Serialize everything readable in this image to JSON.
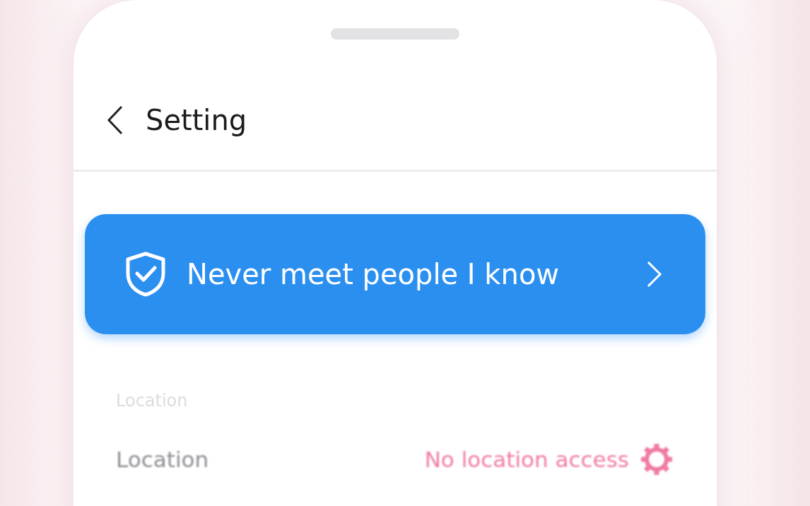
{
  "header": {
    "title": "Setting"
  },
  "banner": {
    "text": "Never meet people I know"
  },
  "sections": [
    {
      "label": "Location",
      "rows": [
        {
          "label": "Location",
          "value": "No location access"
        }
      ]
    }
  ]
}
